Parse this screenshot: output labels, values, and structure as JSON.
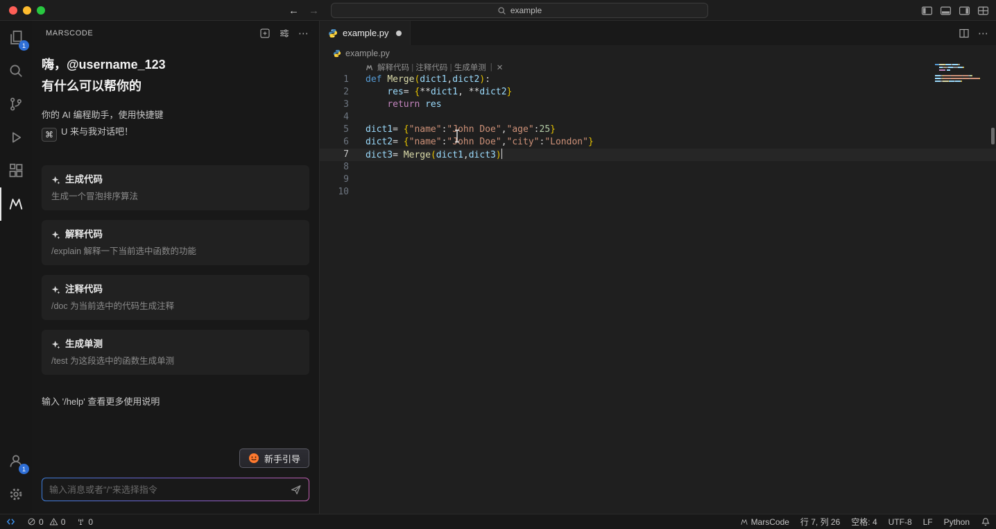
{
  "titlebar": {
    "search_text": "example"
  },
  "activitybar": {
    "explorer_badge": "1",
    "accounts_badge": "1"
  },
  "sidebar": {
    "title": "MARSCODE",
    "greeting_line1": "嗨，@username_123",
    "greeting_line2": "有什么可以帮你的",
    "intro_line1": "你的 AI 编程助手，使用快捷键",
    "shortcut_key": "⌘",
    "intro_line2": "U 来与我对话吧！",
    "cards": [
      {
        "title": "生成代码",
        "desc": "生成一个冒泡排序算法"
      },
      {
        "title": "解释代码",
        "desc": "/explain 解释一下当前选中函数的功能"
      },
      {
        "title": "注释代码",
        "desc": "/doc 为当前选中的代码生成注释"
      },
      {
        "title": "生成单测",
        "desc": "/test 为这段选中的函数生成单测"
      }
    ],
    "help_hint": "输入 '/help' 查看更多使用说明",
    "guide_button_label": "新手引导",
    "input_placeholder": "输入消息或者\"/\"来选择指令"
  },
  "editor": {
    "tab_label": "example.py",
    "breadcrumb": "example.py",
    "codelens": [
      "解释代码",
      "注释代码",
      "生成单测"
    ],
    "codelens_close": "✕",
    "lines": [
      {
        "num": 1,
        "tokens": [
          [
            "def ",
            "kw"
          ],
          [
            "Merge",
            "fn"
          ],
          [
            "(",
            "br"
          ],
          [
            "dict1",
            "vr"
          ],
          [
            ",",
            "pl"
          ],
          [
            "dict2",
            "vr"
          ],
          [
            ")",
            "br"
          ],
          [
            ":",
            "pl"
          ]
        ]
      },
      {
        "num": 2,
        "tokens": [
          [
            "    ",
            "pl"
          ],
          [
            "res",
            "vr"
          ],
          [
            "= ",
            "pl"
          ],
          [
            "{",
            "br"
          ],
          [
            "**",
            "pl"
          ],
          [
            "dict1",
            "vr"
          ],
          [
            ", ",
            "pl"
          ],
          [
            "**",
            "pl"
          ],
          [
            "dict2",
            "vr"
          ],
          [
            "}",
            "br"
          ]
        ]
      },
      {
        "num": 3,
        "tokens": [
          [
            "    ",
            "pl"
          ],
          [
            "return",
            "ct"
          ],
          [
            " ",
            "pl"
          ],
          [
            "res",
            "vr"
          ]
        ]
      },
      {
        "num": 4,
        "tokens": []
      },
      {
        "num": 5,
        "tokens": [
          [
            "dict1",
            "vr"
          ],
          [
            "= ",
            "pl"
          ],
          [
            "{",
            "br"
          ],
          [
            "\"name\"",
            "st"
          ],
          [
            ":",
            "pl"
          ],
          [
            "\"John Doe\"",
            "st"
          ],
          [
            ",",
            "pl"
          ],
          [
            "\"age\"",
            "st"
          ],
          [
            ":",
            "pl"
          ],
          [
            "25",
            "nm"
          ],
          [
            "}",
            "br"
          ]
        ]
      },
      {
        "num": 6,
        "tokens": [
          [
            "dict2",
            "vr"
          ],
          [
            "= ",
            "pl"
          ],
          [
            "{",
            "br"
          ],
          [
            "\"name\"",
            "st"
          ],
          [
            ":",
            "pl"
          ],
          [
            "\"John Doe\"",
            "st"
          ],
          [
            ",",
            "pl"
          ],
          [
            "\"city\"",
            "st"
          ],
          [
            ":",
            "pl"
          ],
          [
            "\"London\"",
            "st"
          ],
          [
            "}",
            "br"
          ]
        ]
      },
      {
        "num": 7,
        "active": true,
        "caret": true,
        "tokens": [
          [
            "dict3",
            "vr"
          ],
          [
            "= ",
            "pl"
          ],
          [
            "Merge",
            "fn"
          ],
          [
            "(",
            "br"
          ],
          [
            "dict1",
            "vr"
          ],
          [
            ",",
            "pl"
          ],
          [
            "dict3",
            "vr"
          ],
          [
            ")",
            "br"
          ]
        ]
      },
      {
        "num": 8,
        "tokens": []
      },
      {
        "num": 9,
        "tokens": []
      },
      {
        "num": 10,
        "tokens": []
      }
    ]
  },
  "statusbar": {
    "errors": "0",
    "warnings": "0",
    "ports": "0",
    "marscode_label": "MarsCode",
    "cursor_position": "行 7, 列 26",
    "indent": "空格: 4",
    "encoding": "UTF-8",
    "eol": "LF",
    "language": "Python",
    "colors": {
      "remote_accent": "#3b8eea",
      "badge": "#2f6fd6"
    }
  }
}
